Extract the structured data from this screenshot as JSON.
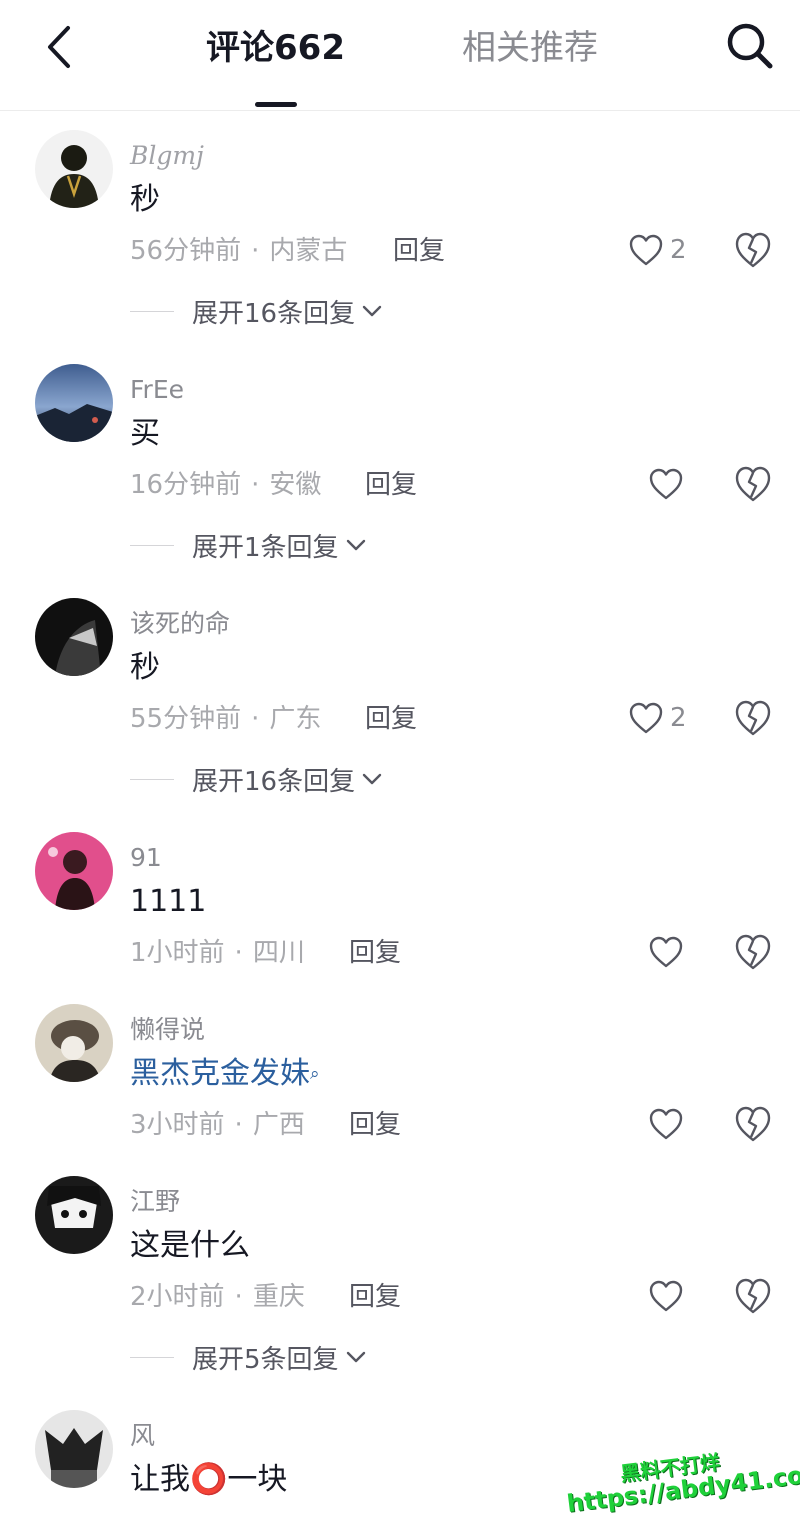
{
  "header": {
    "back_icon": "chevron-left-icon",
    "tabs": [
      {
        "label": "评论662",
        "active": true
      },
      {
        "label": "相关推荐",
        "active": false
      }
    ],
    "search_icon": "search-icon"
  },
  "colors": {
    "text_primary": "#161823",
    "text_secondary": "#8a8b91",
    "link": "#2b5f9e",
    "watermark": "#1fd13a"
  },
  "reply_label": "回复",
  "comments": [
    {
      "username": "Blgmj",
      "text": "秒",
      "time": "56分钟前",
      "location": "内蒙古",
      "likes": "2",
      "expand": "展开16条回复"
    },
    {
      "username": "FrEe",
      "text": "买",
      "time": "16分钟前",
      "location": "安徽",
      "likes": "",
      "expand": "展开1条回复"
    },
    {
      "username": "该死的命",
      "text": "秒",
      "time": "55分钟前",
      "location": "广东",
      "likes": "2",
      "expand": "展开16条回复"
    },
    {
      "username": "91",
      "text": "1111",
      "time": "1小时前",
      "location": "四川",
      "likes": ""
    },
    {
      "username": "懒得说",
      "text": "黑杰克金发妹",
      "time": "3小时前",
      "location": "广西",
      "likes": ""
    },
    {
      "username": "江野",
      "text": "这是什么",
      "time": "2小时前",
      "location": "重庆",
      "likes": "",
      "expand": "展开5条回复"
    },
    {
      "username": "风",
      "text": "让我⭕一块"
    }
  ],
  "watermark": {
    "line1": "黑料不打烊",
    "line2": "https://abdy41.com"
  }
}
